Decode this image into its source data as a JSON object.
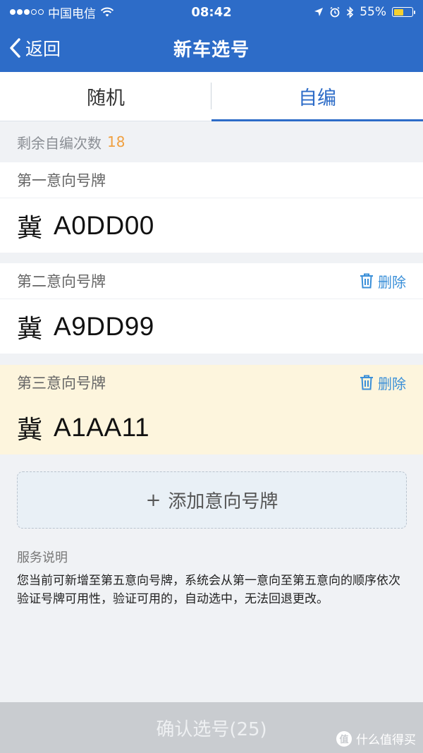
{
  "status_bar": {
    "carrier": "中国电信",
    "time": "08:42",
    "battery_percent": "55%",
    "battery_level": 0.55,
    "signal_bars_filled": 3,
    "signal_bars_total": 5,
    "icons": [
      "wifi-icon",
      "location-icon",
      "alarm-icon",
      "bluetooth-icon",
      "battery-icon"
    ]
  },
  "nav": {
    "back_label": "返回",
    "title": "新车选号"
  },
  "tabs": [
    {
      "label": "随机",
      "active": false
    },
    {
      "label": "自编",
      "active": true
    }
  ],
  "remaining": {
    "label": "剩余自编次数",
    "count": "18"
  },
  "plates": [
    {
      "label": "第一意向号牌",
      "province": "冀",
      "number": "A0DD00",
      "deletable": false,
      "highlight": false
    },
    {
      "label": "第二意向号牌",
      "province": "冀",
      "number": "A9DD99",
      "deletable": true,
      "delete_label": "删除",
      "highlight": false
    },
    {
      "label": "第三意向号牌",
      "province": "冀",
      "number": "A1AA11",
      "deletable": true,
      "delete_label": "删除",
      "highlight": true
    }
  ],
  "add_button": {
    "icon": "+",
    "label": "添加意向号牌"
  },
  "notes": {
    "title": "服务说明",
    "text": "您当前可新增至第五意向号牌，系统会从第一意向至第五意向的顺序依次验证号牌可用性，验证可用的，自动选中，无法回退更改。"
  },
  "confirm_button": {
    "label": "确认选号(25)"
  },
  "watermark": {
    "badge": "值",
    "text": "什么值得买"
  },
  "colors": {
    "header": "#2d6cc8",
    "accent_orange": "#f0a040",
    "delete_blue": "#3a8fd8",
    "highlight_bg": "#fdf5dd",
    "confirm_bg": "#c9ccd0"
  }
}
